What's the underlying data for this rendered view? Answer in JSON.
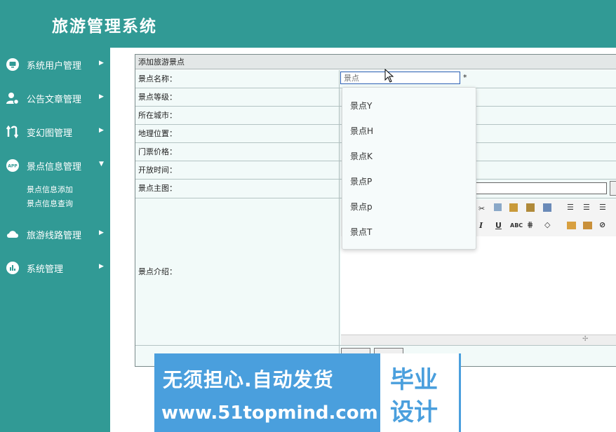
{
  "app": {
    "title": "旅游管理系统"
  },
  "sidebar": {
    "items": [
      {
        "label": "系统用户管理",
        "icon": "monitor-icon",
        "arrow": "▶"
      },
      {
        "label": "公告文章管理",
        "icon": "user-gear-icon",
        "arrow": "▶"
      },
      {
        "label": "变幻图管理",
        "icon": "swap-icon",
        "arrow": "▶"
      },
      {
        "label": "景点信息管理",
        "icon": "app-icon",
        "arrow": "▼",
        "icon_text": "APP"
      },
      {
        "label": "旅游线路管理",
        "icon": "cloud-icon",
        "arrow": "▶"
      },
      {
        "label": "系统管理",
        "icon": "chart-icon",
        "arrow": "▶"
      }
    ],
    "subitems": [
      "景点信息添加",
      "景点信息查询"
    ]
  },
  "form": {
    "header": "添加旅游景点",
    "labels": {
      "name": "景点名称：",
      "level": "景点等级：",
      "city": "所在城市：",
      "location": "地理位置：",
      "price": "门票价格：",
      "open_time": "开放时间：",
      "main_image": "景点主图：",
      "intro": "景点介绍："
    },
    "name_placeholder": "景点",
    "required_mark": "*",
    "autocomplete": [
      "景点Y",
      "景点H",
      "景点K",
      "景点P",
      "景点p",
      "景点T"
    ],
    "toolbar": {
      "italic": "I",
      "underline": "U",
      "strike": "ABC"
    }
  },
  "banner": {
    "line1": "无须担心.自动发货",
    "line2": "www.51topmind.com",
    "badge_line1": "毕业",
    "badge_line2": "设计"
  },
  "colors": {
    "teal": "#319a95",
    "banner_blue": "#4a9fdd"
  }
}
